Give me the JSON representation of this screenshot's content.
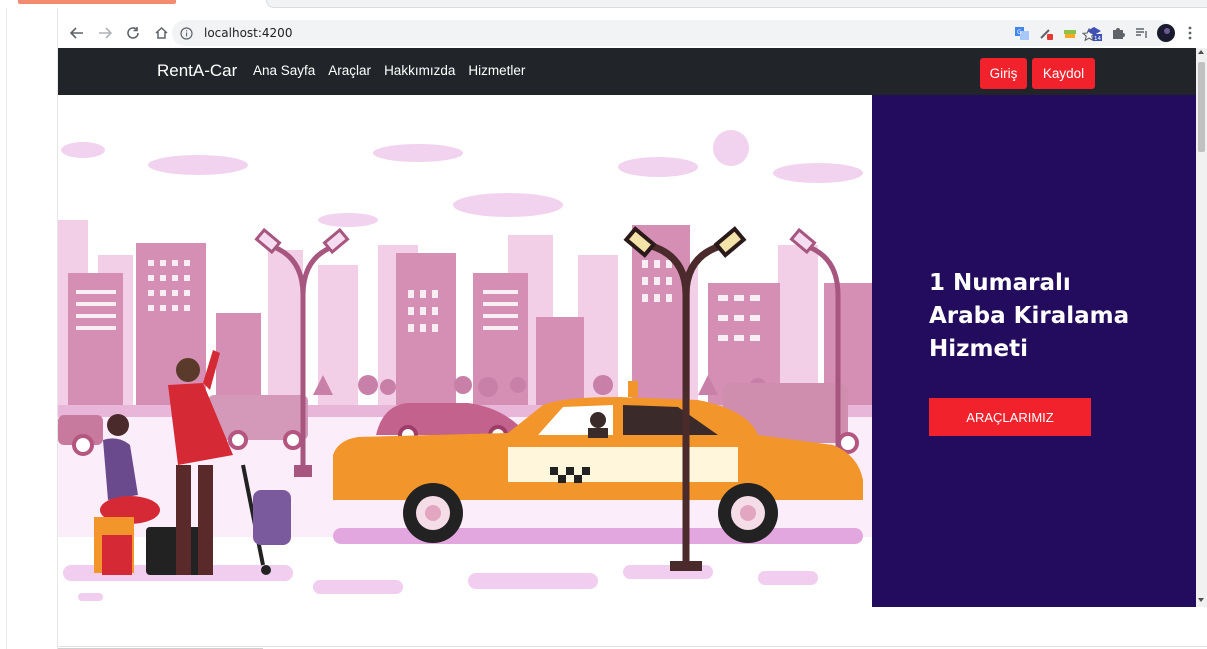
{
  "browser": {
    "url": "localhost:4200",
    "icons": [
      "back-icon",
      "forward-icon",
      "reload-icon",
      "home-icon",
      "info-icon",
      "star-icon",
      "translate-icon",
      "eyedropper-icon",
      "cash-icon",
      "extension-icon",
      "puzzle-icon",
      "reading-list-icon",
      "profile-avatar",
      "menu-icon"
    ],
    "badge_count": "14",
    "tab_accent_color": "#f28b6f"
  },
  "navbar": {
    "brand": "RentA-Car",
    "links": [
      "Ana Sayfa",
      "Araçlar",
      "Hakkımızda",
      "Hizmetler"
    ],
    "login_label": "Giriş",
    "register_label": "Kaydol",
    "background_color": "#212529",
    "button_color": "#f1222c"
  },
  "hero": {
    "title_lines": [
      "1 Numaralı",
      "Araba Kiralama",
      "Hizmeti"
    ],
    "cta_label": "ARAÇLARIMIZ",
    "panel_color": "#230c5e",
    "illustration": "city-taxi-illustration"
  }
}
